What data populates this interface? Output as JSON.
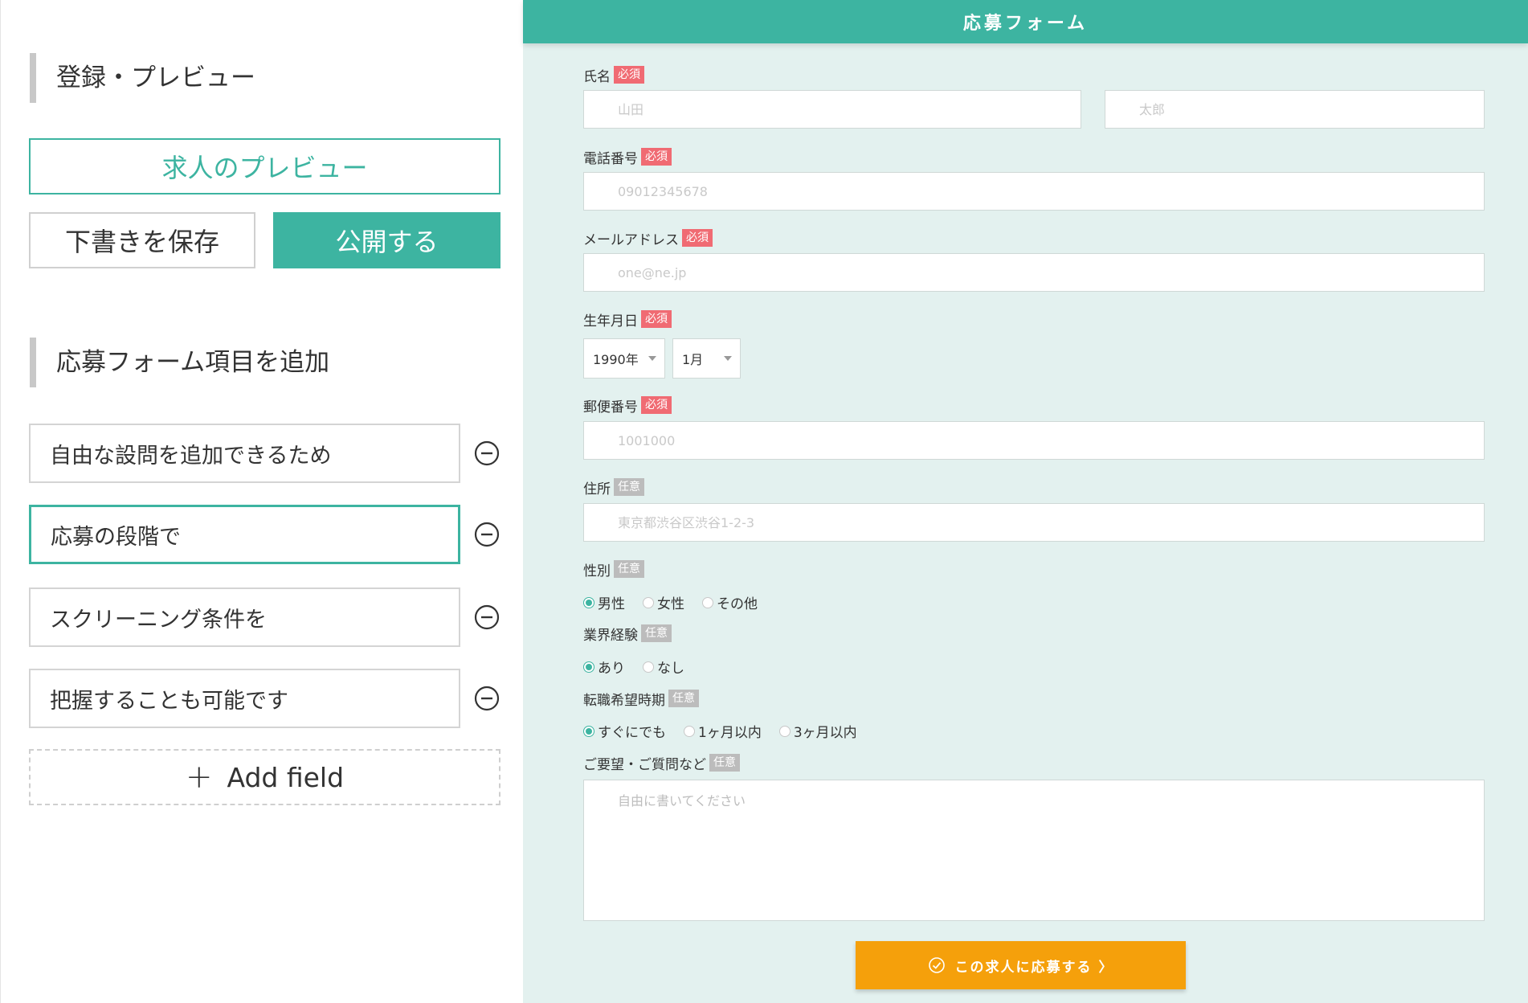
{
  "left": {
    "register_title": "登録・プレビュー",
    "preview_button": "求人のプレビュー",
    "draft_button": "下書きを保存",
    "publish_button": "公開する",
    "add_section_title": "応募フォーム項目を追加",
    "custom_fields": [
      {
        "value": "自由な設問を追加できるため",
        "focused": false
      },
      {
        "value": "応募の段階で",
        "focused": true
      },
      {
        "value": "スクリーニング条件を",
        "focused": false
      },
      {
        "value": "把握することも可能です",
        "focused": false
      }
    ],
    "add_field_icon": "plus-icon",
    "add_field_label": "Add field",
    "remove_icon": "minus-circle-icon"
  },
  "form": {
    "title": "応募フォーム",
    "required_badge": "必須",
    "optional_badge": "任意",
    "name": {
      "label": "氏名",
      "last_placeholder": "山田",
      "first_placeholder": "太郎"
    },
    "phone": {
      "label": "電話番号",
      "placeholder": "09012345678"
    },
    "email": {
      "label": "メールアドレス",
      "placeholder": "one@ne.jp"
    },
    "birth": {
      "label": "生年月日",
      "year": "1990年",
      "month": "1月"
    },
    "postal": {
      "label": "郵便番号",
      "placeholder": "1001000"
    },
    "address": {
      "label": "住所",
      "placeholder": "東京都渋谷区渋谷1-2-3"
    },
    "gender": {
      "label": "性別",
      "options": [
        "男性",
        "女性",
        "その他"
      ],
      "selected": "男性"
    },
    "experience": {
      "label": "業界経験",
      "options": [
        "あり",
        "なし"
      ],
      "selected": "あり"
    },
    "timing": {
      "label": "転職希望時期",
      "options": [
        "すぐにでも",
        "1ヶ月以内",
        "3ヶ月以内"
      ],
      "selected": "すぐにでも"
    },
    "message": {
      "label": "ご要望・ご質問など",
      "placeholder": "自由に書いてください"
    },
    "submit_icon": "check-circle-icon",
    "submit_label": "この求人に応募する 〉"
  },
  "colors": {
    "accent": "#3db4a1",
    "form_bg": "#e3f1ef",
    "required": "#f06b73",
    "optional": "#bcbcbc",
    "submit": "#f5a00b"
  }
}
